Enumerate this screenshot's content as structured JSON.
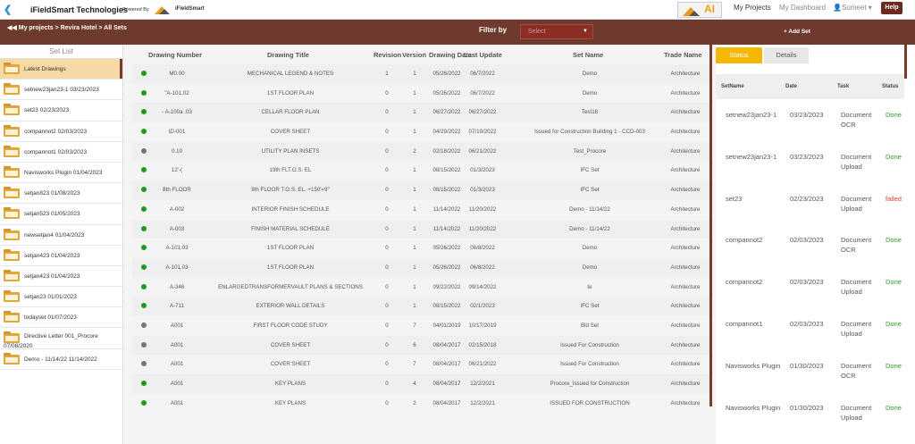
{
  "header": {
    "back_icon": "chevron-left",
    "app_name": "iFieldSmart Technologies",
    "powered_by": "Powered By",
    "powered_logo_text": "iFieldSmart",
    "ai_logo_text": "AI",
    "links": [
      "My Projects",
      "My Dashboard"
    ],
    "user": "Sumeet",
    "help": "Help"
  },
  "nav": {
    "breadcrumb": "My projects > Revira Hotel > All Sets",
    "filter_label": "Filter by",
    "filter_placeholder": "Select",
    "add_set": "Add Set"
  },
  "set_list": {
    "title": "Set List",
    "items": [
      "Latest Drawings",
      "setnew23jan23-1  03/23/2023",
      "set23  02/23/2023",
      "compannot2  02/03/2023",
      "compannot1  02/03/2023",
      "Navisworks Plugin  01/04/2023",
      "setjan823  01/08/2023",
      "setjan523  01/05/2023",
      "newsetjan4  01/04/2023",
      "setjan423  01/04/2023",
      "setjan423  01/04/2023",
      "setjan23  01/01/2023",
      "todayset  01/07/2023",
      "Directive Letter 001_Procore  07/08/2020",
      "Demo - 11/14/22  11/14/2022"
    ]
  },
  "grid": {
    "columns": [
      "Drawing Number",
      "Drawing Title",
      "Revision",
      "Version",
      "Drawing Date",
      "Last Update",
      "Set Name",
      "Trade Name"
    ],
    "rows": [
      {
        "status": "green",
        "num": "M0.00",
        "title": "MECHANICAL LEGEND & NOTES",
        "rev": "1",
        "ver": "1",
        "date": "05/26/2022",
        "update": "06/7/2022",
        "set": "Demo",
        "trade": "Architecture"
      },
      {
        "status": "green",
        "num": "\"A-101.02",
        "title": "1ST FLOOR PLAN",
        "rev": "0",
        "ver": "1",
        "date": "05/26/2022",
        "update": "06/7/2022",
        "set": "Demo",
        "trade": "Architecture"
      },
      {
        "status": "green",
        "num": "- A-100a .03",
        "title": "CELLAR FLOOR PLAN",
        "rev": "0",
        "ver": "1",
        "date": "06/27/2022",
        "update": "06/27/2022",
        "set": "Test18",
        "trade": "Architecture"
      },
      {
        "status": "green",
        "num": "ID-001",
        "title": "COVER SHEET",
        "rev": "0",
        "ver": "1",
        "date": "04/29/2022",
        "update": "07/19/2022",
        "set": "Issued for Construction Building 1 - CCD-003",
        "trade": "Architecture"
      },
      {
        "status": "grey",
        "num": "0.10",
        "title": "UTILITY PLAN INSETS",
        "rev": "0",
        "ver": "2",
        "date": "02/18/2022",
        "update": "06/21/2022",
        "set": "Test_Procore",
        "trade": "Architecture"
      },
      {
        "status": "green",
        "num": "12'-(",
        "title": "19th FLT.O.S. EL",
        "rev": "0",
        "ver": "1",
        "date": "08/15/2022",
        "update": "01/3/2023",
        "set": "IFC Set",
        "trade": "Architecture"
      },
      {
        "status": "green",
        "num": "8th FLOOR",
        "title": "9th FLOOR T.O.S. EL. +150'=9\"",
        "rev": "0",
        "ver": "1",
        "date": "08/15/2022",
        "update": "01/3/2023",
        "set": "IFC Set",
        "trade": "Architecture"
      },
      {
        "status": "green",
        "num": "A-002",
        "title": "INTERIOR FINISH SCHEDULE",
        "rev": "0",
        "ver": "1",
        "date": "11/14/2022",
        "update": "11/20/2022",
        "set": "Demo - 11/14/22",
        "trade": "Architecture"
      },
      {
        "status": "green",
        "num": "A-003",
        "title": "FINISH MATERIAL SCHEDULE",
        "rev": "0",
        "ver": "1",
        "date": "11/14/2022",
        "update": "11/20/2022",
        "set": "Demo - 11/14/22",
        "trade": "Architecture"
      },
      {
        "status": "green",
        "num": "A-101.03",
        "title": "1ST FLOOR PLAN",
        "rev": "0",
        "ver": "1",
        "date": "05/26/2022",
        "update": "06/8/2022",
        "set": "Demo",
        "trade": "Architecture"
      },
      {
        "status": "green",
        "num": "A-101.03",
        "title": "1ST FLOOR PLAN",
        "rev": "0",
        "ver": "1",
        "date": "05/26/2022",
        "update": "06/8/2022",
        "set": "Demo",
        "trade": "Architecture"
      },
      {
        "status": "green",
        "num": "A-346",
        "title": "ENLARGEDTRANSFORMERVAULT PLANS & SECTIONS",
        "rev": "0",
        "ver": "1",
        "date": "09/22/2022",
        "update": "09/14/2022",
        "set": "te",
        "trade": "Architecture"
      },
      {
        "status": "green",
        "num": "A-711",
        "title": "EXTERIOR WALL DETAILS",
        "rev": "0",
        "ver": "1",
        "date": "08/15/2022",
        "update": "02/1/2023",
        "set": "IFC Set",
        "trade": "Architecture"
      },
      {
        "status": "grey",
        "num": "A001",
        "title": "FIRST FLOOR CODE STUDY",
        "rev": "0",
        "ver": "7",
        "date": "04/01/2019",
        "update": "10/17/2019",
        "set": "Bld Set",
        "trade": "Architecture"
      },
      {
        "status": "grey",
        "num": "A001",
        "title": "COVER SHEET",
        "rev": "0",
        "ver": "6",
        "date": "08/04/2017",
        "update": "02/15/2018",
        "set": "Issued For Construction",
        "trade": "Architecture"
      },
      {
        "status": "grey",
        "num": "A001",
        "title": "COVER SHEET",
        "rev": "0",
        "ver": "7",
        "date": "08/04/2017",
        "update": "06/21/2022",
        "set": "Issued For Construction",
        "trade": "Architecture"
      },
      {
        "status": "green",
        "num": "A001",
        "title": "KEY PLANS",
        "rev": "0",
        "ver": "4",
        "date": "08/04/2017",
        "update": "12/2/2021",
        "set": "Procore_Issued for Construction",
        "trade": "Architecture"
      },
      {
        "status": "green",
        "num": "A001",
        "title": "KEY PLANS",
        "rev": "0",
        "ver": "2",
        "date": "08/04/2017",
        "update": "12/2/2021",
        "set": "ISSUED FOR CONSTRUCTION",
        "trade": "Architecture"
      }
    ]
  },
  "status_panel": {
    "tabs": [
      "Status",
      "Details"
    ],
    "columns": [
      "SetName",
      "Date",
      "Task",
      "Status"
    ],
    "rows": [
      {
        "set": "setnew23jan23-1",
        "date": "03/23/2023",
        "task": "Document OCR",
        "status": "Done"
      },
      {
        "set": "setnew23jan23-1",
        "date": "03/23/2023",
        "task": "Document Upload",
        "status": "Done"
      },
      {
        "set": "set23",
        "date": "02/23/2023",
        "task": "Document Upload",
        "status": "failed"
      },
      {
        "set": "compannot2",
        "date": "02/03/2023",
        "task": "Document OCR",
        "status": "Done"
      },
      {
        "set": "compannot2",
        "date": "02/03/2023",
        "task": "Document Upload",
        "status": "Done"
      },
      {
        "set": "compannot1",
        "date": "02/03/2023",
        "task": "Document Upload",
        "status": "Done"
      },
      {
        "set": "Navisworks Plugin",
        "date": "01/30/2023",
        "task": "Document OCR",
        "status": "Done"
      },
      {
        "set": "Navisworks Plugin",
        "date": "01/30/2023",
        "task": "Document Upload",
        "status": "Done"
      }
    ]
  },
  "colors": {
    "accent": "#6e3a2e",
    "tab_active": "#f5b700",
    "done": "#2e9a2e",
    "failed": "#e23a2a",
    "dot_green": "#1f9a1f",
    "dot_grey": "#777777"
  }
}
